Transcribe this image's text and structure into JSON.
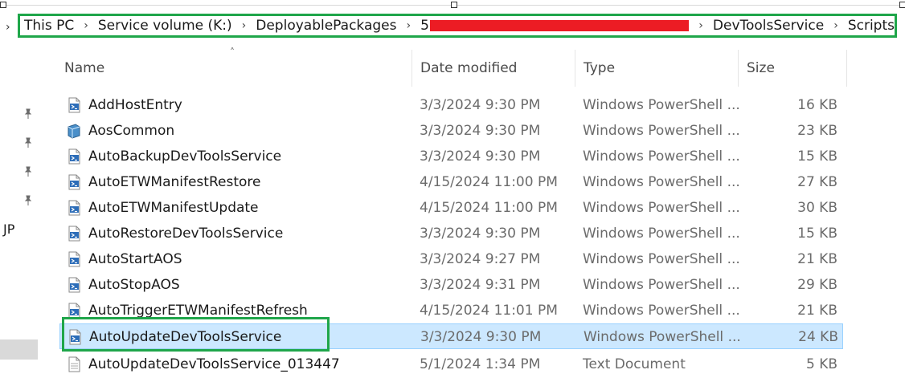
{
  "breadcrumb": {
    "items": [
      "This PC",
      "Service volume (K:)",
      "DeployablePackages",
      "5",
      "DevToolsService",
      "Scripts"
    ]
  },
  "nav": {
    "partial_label": "JP"
  },
  "columns": {
    "name": "Name",
    "date": "Date modified",
    "type": "Type",
    "size": "Size"
  },
  "files": [
    {
      "name": "AddHostEntry",
      "date": "3/3/2024 9:30 PM",
      "type": "Windows PowerShell ...",
      "size": "16 KB",
      "icon": "powershell-script-icon"
    },
    {
      "name": "AosCommon",
      "date": "3/3/2024 9:30 PM",
      "type": "Windows PowerShell ...",
      "size": "23 KB",
      "icon": "powershell-module-icon"
    },
    {
      "name": "AutoBackupDevToolsService",
      "date": "3/3/2024 9:30 PM",
      "type": "Windows PowerShell ...",
      "size": "15 KB",
      "icon": "powershell-script-icon"
    },
    {
      "name": "AutoETWManifestRestore",
      "date": "4/15/2024 11:00 PM",
      "type": "Windows PowerShell ...",
      "size": "27 KB",
      "icon": "powershell-script-icon"
    },
    {
      "name": "AutoETWManifestUpdate",
      "date": "4/15/2024 11:00 PM",
      "type": "Windows PowerShell ...",
      "size": "30 KB",
      "icon": "powershell-script-icon"
    },
    {
      "name": "AutoRestoreDevToolsService",
      "date": "3/3/2024 9:30 PM",
      "type": "Windows PowerShell ...",
      "size": "15 KB",
      "icon": "powershell-script-icon"
    },
    {
      "name": "AutoStartAOS",
      "date": "3/3/2024 9:27 PM",
      "type": "Windows PowerShell ...",
      "size": "21 KB",
      "icon": "powershell-script-icon"
    },
    {
      "name": "AutoStopAOS",
      "date": "3/3/2024 9:31 PM",
      "type": "Windows PowerShell ...",
      "size": "29 KB",
      "icon": "powershell-script-icon"
    },
    {
      "name": "AutoTriggerETWManifestRefresh",
      "date": "4/15/2024 11:01 PM",
      "type": "Windows PowerShell ...",
      "size": "21 KB",
      "icon": "powershell-script-icon"
    },
    {
      "name": "AutoUpdateDevToolsService",
      "date": "3/3/2024 9:30 PM",
      "type": "Windows PowerShell ...",
      "size": "24 KB",
      "icon": "powershell-script-icon",
      "selected": true
    }
  ],
  "cut_file": {
    "name": "AutoUpdateDevToolsService_013447",
    "date": "5/1/2024 1:34 PM",
    "type": "Text Document",
    "size": "5 KB",
    "icon": "text-document-icon"
  },
  "colors": {
    "highlight": "#1fa64a",
    "redaction": "#ec1c24",
    "selection": "#cce8ff"
  }
}
